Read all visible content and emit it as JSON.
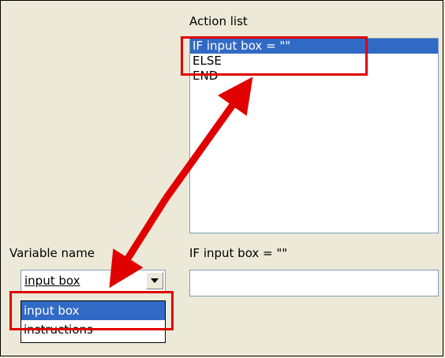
{
  "action_list": {
    "label": "Action list",
    "items": [
      "IF input box = \"\"",
      "ELSE",
      "END"
    ],
    "selected_index": 0
  },
  "variable_name": {
    "label": "Variable name",
    "value": "input box",
    "options": [
      "input box",
      "instructions"
    ],
    "selected_index": 0
  },
  "expression": {
    "label": "IF input box = \"\"",
    "value": ""
  },
  "colors": {
    "highlight": "#e00000",
    "selection": "#316ac5",
    "panel": "#ece9d8"
  }
}
